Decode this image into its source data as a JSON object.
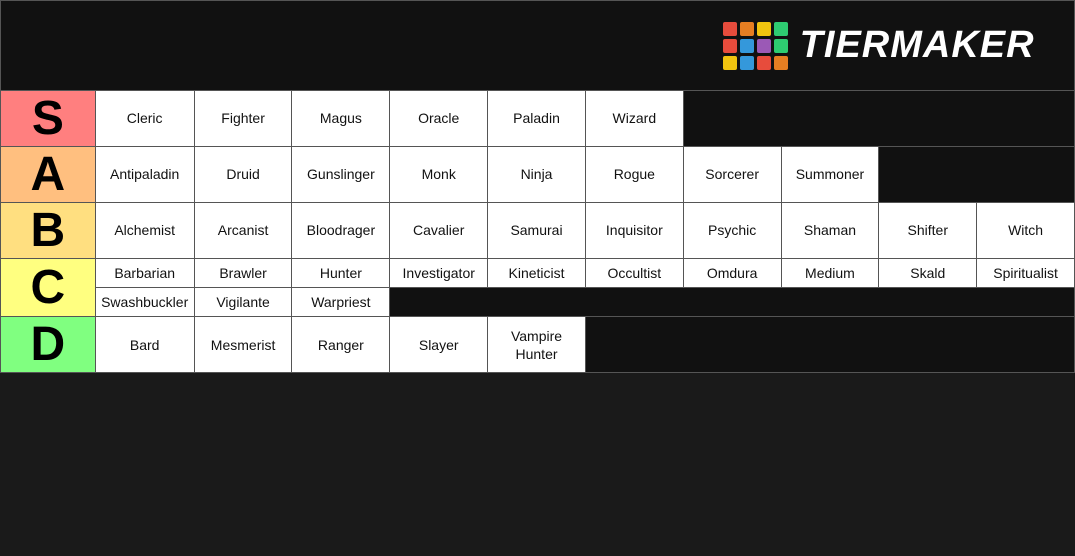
{
  "logo": {
    "text": "TierMaker",
    "dots": [
      {
        "color": "#e74c3c"
      },
      {
        "color": "#e67e22"
      },
      {
        "color": "#f1c40f"
      },
      {
        "color": "#2ecc71"
      },
      {
        "color": "#e74c3c"
      },
      {
        "color": "#3498db"
      },
      {
        "color": "#9b59b6"
      },
      {
        "color": "#2ecc71"
      },
      {
        "color": "#f1c40f"
      },
      {
        "color": "#3498db"
      },
      {
        "color": "#e74c3c"
      },
      {
        "color": "#e67e22"
      }
    ]
  },
  "tiers": [
    {
      "label": "S",
      "class": "tier-s",
      "items": [
        "Cleric",
        "Fighter",
        "Magus",
        "Oracle",
        "Paladin",
        "Wizard"
      ]
    },
    {
      "label": "A",
      "class": "tier-a",
      "items": [
        "Antipaladin",
        "Druid",
        "Gunslinger",
        "Monk",
        "Ninja",
        "Rogue",
        "Sorcerer",
        "Summoner"
      ]
    },
    {
      "label": "B",
      "class": "tier-b",
      "items": [
        "Alchemist",
        "Arcanist",
        "Bloodrager",
        "Cavalier",
        "Samurai",
        "Inquisitor",
        "Psychic",
        "Shaman",
        "Shifter",
        "Witch"
      ]
    },
    {
      "label": "C",
      "class": "tier-c",
      "items_row1": [
        "Barbarian",
        "Brawler",
        "Hunter",
        "Investigator",
        "Kineticist",
        "Occultist",
        "Omdura",
        "Medium",
        "Skald",
        "Spiritualist"
      ],
      "items_row2": [
        "Swashbuckler",
        "Vigilante",
        "Warpriest"
      ]
    },
    {
      "label": "D",
      "class": "tier-d",
      "items": [
        "Bard",
        "Mesmerist",
        "Ranger",
        "Slayer",
        "Vampire Hunter"
      ]
    }
  ]
}
